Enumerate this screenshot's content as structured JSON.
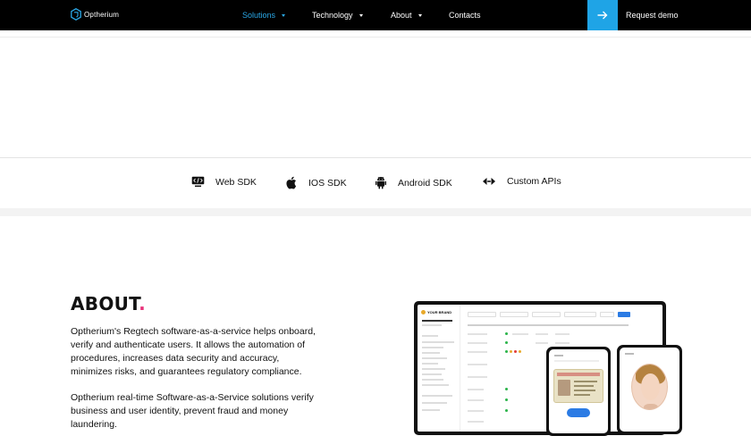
{
  "nav": {
    "brand": "Optherium",
    "items": [
      {
        "label": "Solutions",
        "has_dropdown": true,
        "active": true
      },
      {
        "label": "Technology",
        "has_dropdown": true,
        "active": false
      },
      {
        "label": "About",
        "has_dropdown": true,
        "active": false
      },
      {
        "label": "Contacts",
        "has_dropdown": false,
        "active": false
      }
    ],
    "cta_label": "Request demo",
    "cta_icon": "arrow-right-icon"
  },
  "sdks": [
    {
      "label": "Web SDK",
      "icon": "web-sdk-icon"
    },
    {
      "label": "IOS SDK",
      "icon": "apple-icon"
    },
    {
      "label": "Android SDK",
      "icon": "android-icon"
    },
    {
      "label": "Custom APIs",
      "icon": "api-icon"
    }
  ],
  "about": {
    "title": "ABOUT",
    "dot": ".",
    "paragraph1": "Optherium's Regtech software-as-a-service helps onboard, verify and authenticate users. It allows the automation of procedures, increases data security and accuracy, minimizes risks, and guarantees regulatory compliance.",
    "paragraph2": "Optherium real-time Software-as-a-Service solutions verify business and user identity, prevent fraud and money laundering."
  },
  "mockup": {
    "brand": "YOUR BRAND"
  },
  "colors": {
    "accent": "#1fa4e6",
    "active_nav": "#2aa7e6",
    "about_dot": "#e8337a",
    "nav_bg": "#000000"
  }
}
